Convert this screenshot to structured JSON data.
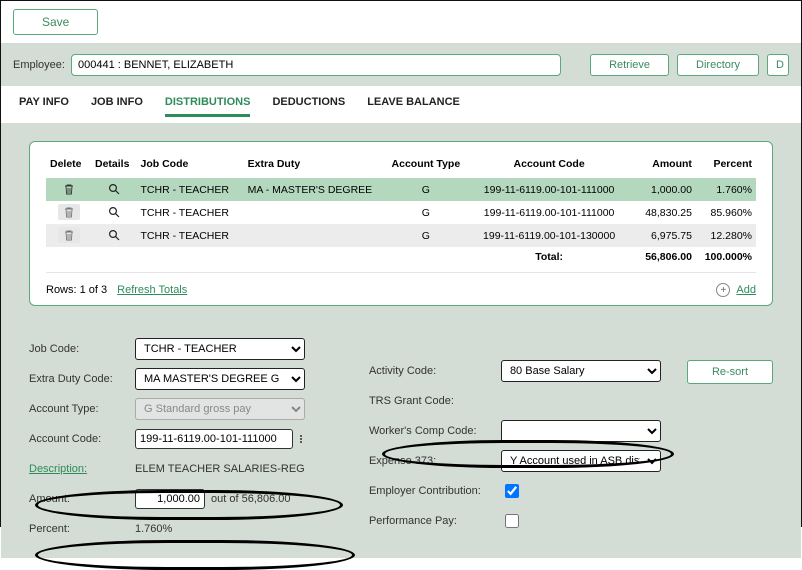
{
  "toolbar": {
    "save": "Save"
  },
  "employee": {
    "label": "Employee:",
    "value": "000441 : BENNET, ELIZABETH"
  },
  "actions": {
    "retrieve": "Retrieve",
    "directory": "Directory",
    "unknown": "D"
  },
  "tabs": {
    "pay": "PAY INFO",
    "job": "JOB INFO",
    "dist": "DISTRIBUTIONS",
    "ded": "DEDUCTIONS",
    "leave": "LEAVE BALANCE"
  },
  "grid": {
    "headers": {
      "delete": "Delete",
      "details": "Details",
      "job": "Job Code",
      "extra": "Extra Duty",
      "acct_type": "Account Type",
      "acct_code": "Account Code",
      "amount": "Amount",
      "percent": "Percent"
    },
    "rows": [
      {
        "job": "TCHR - TEACHER",
        "extra": "MA - MASTER'S DEGREE",
        "type": "G",
        "code": "199-11-6119.00-101-111000",
        "amount": "1,000.00",
        "percent": "1.760%"
      },
      {
        "job": "TCHR - TEACHER",
        "extra": "",
        "type": "G",
        "code": "199-11-6119.00-101-111000",
        "amount": "48,830.25",
        "percent": "85.960%"
      },
      {
        "job": "TCHR - TEACHER",
        "extra": "",
        "type": "G",
        "code": "199-11-6119.00-101-130000",
        "amount": "6,975.75",
        "percent": "12.280%"
      }
    ],
    "total_label": "Total:",
    "total_amount": "56,806.00",
    "total_percent": "100.000%",
    "rows_text": "Rows: 1 of 3",
    "refresh": "Refresh Totals",
    "add": "Add"
  },
  "form": {
    "job_code": {
      "label": "Job Code:",
      "value": "TCHR - TEACHER"
    },
    "extra_duty": {
      "label": "Extra Duty Code:",
      "value": "MA MASTER'S DEGREE G"
    },
    "acct_type": {
      "label": "Account Type:",
      "value": "G Standard gross pay"
    },
    "acct_code": {
      "label": "Account Code:",
      "value": "199-11-6119.00-101-111000"
    },
    "desc": {
      "label": "Description:",
      "value": "ELEM TEACHER SALARIES-REG"
    },
    "amount": {
      "label": "Amount:",
      "value": "1,000.00",
      "suffix": "out of  56,806.00"
    },
    "percent": {
      "label": "Percent:",
      "value": "1.760%"
    },
    "activity": {
      "label": "Activity Code:",
      "value": "80 Base Salary"
    },
    "trs": {
      "label": "TRS Grant Code:"
    },
    "wcc": {
      "label": "Worker's Comp Code:",
      "value": ""
    },
    "exp373": {
      "label": "Expense 373:",
      "value": "Y Account used in ASB distr"
    },
    "emp_contrib": {
      "label": "Employer Contribution:"
    },
    "perf_pay": {
      "label": "Performance Pay:"
    },
    "resort": "Re-sort"
  }
}
